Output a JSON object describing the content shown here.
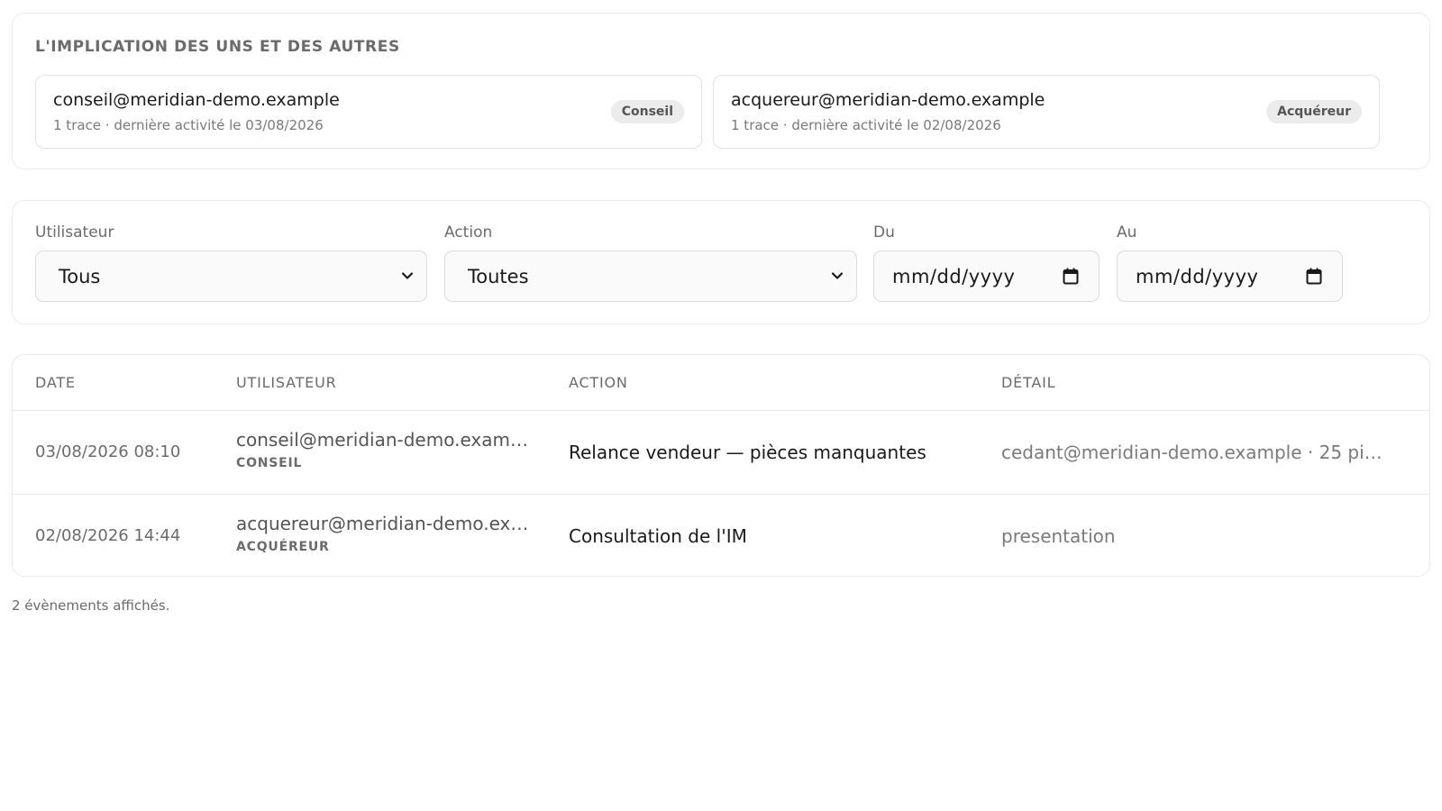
{
  "involvement": {
    "title": "L'IMPLICATION DES UNS ET DES AUTRES",
    "people": [
      {
        "email": "conseil@meridian-demo.example",
        "meta": "1 trace · dernière activité le 03/08/2026",
        "badge": "Conseil"
      },
      {
        "email": "acquereur@meridian-demo.example",
        "meta": "1 trace · dernière activité le 02/08/2026",
        "badge": "Acquéreur"
      }
    ]
  },
  "filters": {
    "user": {
      "label": "Utilisateur",
      "value": "Tous"
    },
    "action": {
      "label": "Action",
      "value": "Toutes"
    },
    "from": {
      "label": "Du",
      "placeholder": "mm/dd/yyyy"
    },
    "to": {
      "label": "Au",
      "placeholder": "mm/dd/yyyy"
    }
  },
  "table": {
    "headers": [
      "DATE",
      "UTILISATEUR",
      "ACTION",
      "DÉTAIL"
    ],
    "rows": [
      {
        "date": "03/08/2026 08:10",
        "user_email": "conseil@meridian-demo.exam…",
        "user_role": "CONSEIL",
        "action": "Relance vendeur — pièces manquantes",
        "detail": "cedant@meridian-demo.example · 25 pi…"
      },
      {
        "date": "02/08/2026 14:44",
        "user_email": "acquereur@meridian-demo.ex…",
        "user_role": "ACQUÉREUR",
        "action": "Consultation de l'IM",
        "detail": "presentation"
      }
    ]
  },
  "footer": {
    "count_text": "2 évènements affichés."
  },
  "icons": {
    "select_arrow": "chevron-down-icon",
    "date_picker": "calendar-icon"
  },
  "colors": {
    "border": "#ebebeb",
    "badge_bg": "#ececec",
    "muted_text": "#6b6b6b"
  }
}
